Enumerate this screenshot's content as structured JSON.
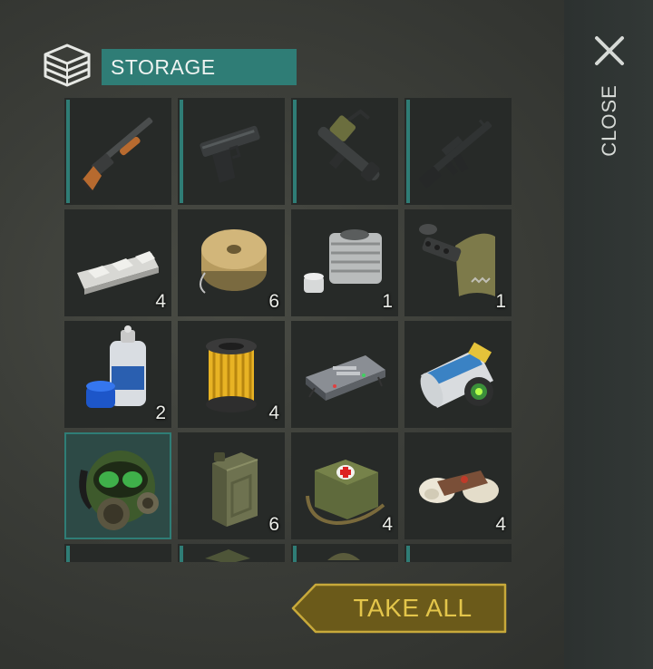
{
  "header": {
    "title": "STORAGE",
    "icon": "storage-crate-icon"
  },
  "close": {
    "label": "CLOSE",
    "icon": "close-x-icon"
  },
  "take_all": {
    "label": "TAKE ALL"
  },
  "colors": {
    "accent": "#2f7d76",
    "gold": "#e3c54a"
  },
  "slots": [
    {
      "item": "shotgun-icon",
      "qty": ""
    },
    {
      "item": "pistol-icon",
      "qty": ""
    },
    {
      "item": "grenade-launcher-icon",
      "qty": ""
    },
    {
      "item": "assault-rifle-icon",
      "qty": ""
    },
    {
      "item": "metal-ingot-icon",
      "qty": "4"
    },
    {
      "item": "wire-spool-icon",
      "qty": "6"
    },
    {
      "item": "engine-cylinder-icon",
      "qty": "1"
    },
    {
      "item": "gun-parts-icon",
      "qty": "1"
    },
    {
      "item": "spray-paint-icon",
      "qty": "2"
    },
    {
      "item": "filter-cartridge-icon",
      "qty": "4"
    },
    {
      "item": "circuit-board-icon",
      "qty": ""
    },
    {
      "item": "magazines-icon",
      "qty": ""
    },
    {
      "item": "gas-mask-icon",
      "qty": ""
    },
    {
      "item": "jerry-can-icon",
      "qty": "6"
    },
    {
      "item": "first-aid-bag-icon",
      "qty": "4"
    },
    {
      "item": "bandage-icon",
      "qty": "4"
    },
    {
      "item": "partial-item-icon",
      "qty": ""
    },
    {
      "item": "partial-item-icon",
      "qty": ""
    },
    {
      "item": "partial-item-icon",
      "qty": ""
    },
    {
      "item": "partial-item-icon",
      "qty": ""
    }
  ]
}
